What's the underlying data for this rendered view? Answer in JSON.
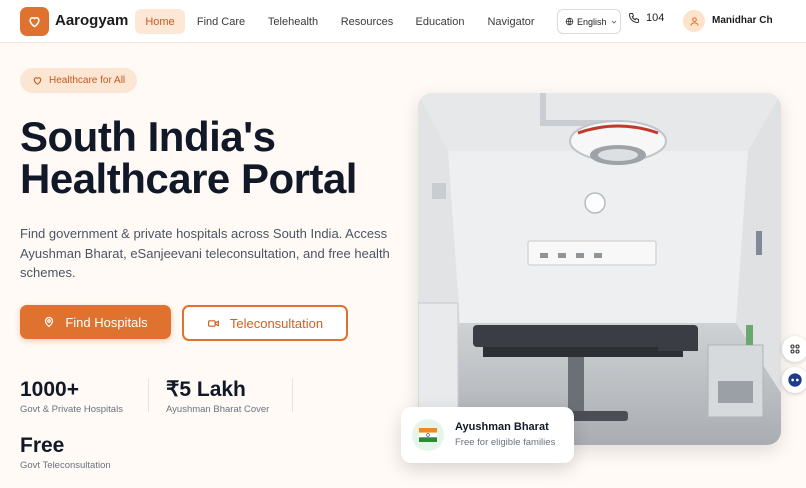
{
  "header": {
    "brand": "Aarogyam",
    "nav": [
      {
        "label": "Home",
        "active": true
      },
      {
        "label": "Find Care",
        "active": false
      },
      {
        "label": "Telehealth",
        "active": false
      },
      {
        "label": "Resources",
        "active": false
      },
      {
        "label": "Education",
        "active": false
      },
      {
        "label": "Navigator",
        "active": false
      }
    ],
    "language": "English",
    "helpline": "104",
    "user_name": "Manidhar Ch"
  },
  "hero": {
    "pill": "Healthcare for All",
    "title_line1": "South India's",
    "title_line2": "Healthcare Portal",
    "description": "Find government & private hospitals across South India. Access Ayushman Bharat, eSanjeevani teleconsultation, and free health schemes.",
    "primary_button": "Find Hospitals",
    "secondary_button": "Teleconsultation",
    "stats": [
      {
        "value": "1000+",
        "label": "Govt & Private Hospitals"
      },
      {
        "value": "₹5 Lakh",
        "label": "Ayushman Bharat Cover"
      },
      {
        "value": "Free",
        "label": "Govt Teleconsultation"
      }
    ]
  },
  "badge": {
    "title": "Ayushman Bharat",
    "subtitle": "Free for eligible families"
  },
  "colors": {
    "accent": "#e0722f",
    "accent_light": "#fde7d6",
    "text_dark": "#111827",
    "text_muted": "#6b7280"
  },
  "icons": {
    "logo": "heart-icon",
    "language": "globe-icon",
    "helpline": "phone-icon",
    "user": "user-icon",
    "primary_button": "map-pin-icon",
    "secondary_button": "video-icon",
    "badge": "india-flag-icon",
    "fab_top": "grid-icon",
    "fab_bottom": "chatbot-icon"
  }
}
